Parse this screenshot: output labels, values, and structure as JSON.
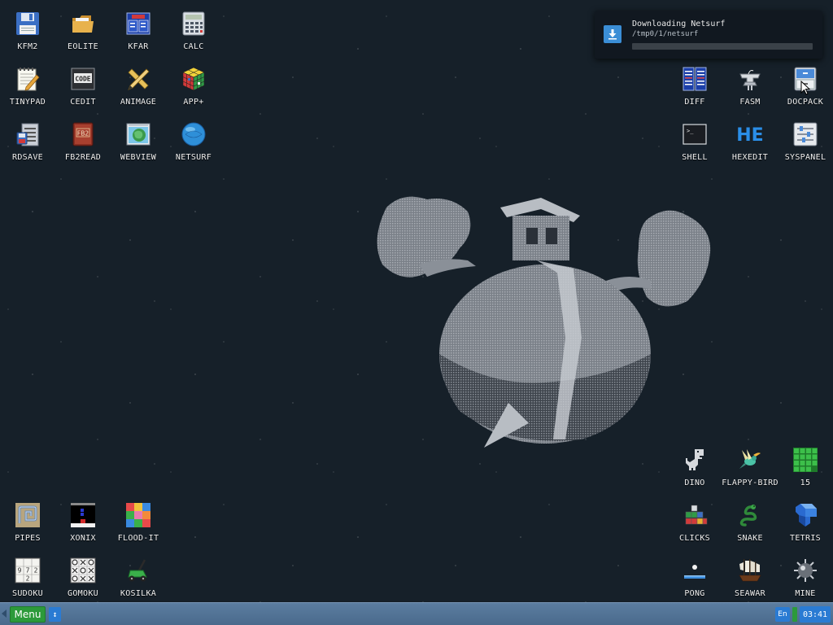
{
  "desktop": {
    "icons": {
      "kfm2": "KFM2",
      "eolite": "EOLITE",
      "kfar": "KFAR",
      "calc": "CALC",
      "tinypad": "TINYPAD",
      "cedit": "CEDIT",
      "animage": "ANIMAGE",
      "app_plus": "APP+",
      "rdsave": "RDSAVE",
      "fb2read": "FB2READ",
      "webview": "WEBVIEW",
      "netsurf": "NETSURF",
      "diff": "DIFF",
      "fasm": "FASM",
      "docpack": "DOCPACK",
      "shell": "SHELL",
      "hexedit": "HEXEDIT",
      "syspanel": "SYSPANEL",
      "dino": "DINO",
      "flappy_bird": "FLAPPY-BIRD",
      "n15": "15",
      "clicks": "CLICKS",
      "snake": "SNAKE",
      "tetris": "TETRIS",
      "pong": "PONG",
      "seawar": "SEAWAR",
      "mine": "MINE",
      "pipes": "PIPES",
      "xonix": "XONIX",
      "flood_it": "FLOOD-IT",
      "sudoku": "SUDOKU",
      "gomoku": "GOMOKU",
      "kosilka": "KOSILKA"
    },
    "icon_glyph_text": {
      "cedit": "CODE",
      "fb2read": "FB2",
      "hexedit": "HE",
      "shell_prompt": ">_",
      "sudoku_digits": [
        "9",
        "7",
        "2",
        "2"
      ]
    }
  },
  "notification": {
    "title": "Downloading Netsurf",
    "path": "/tmp0/1/netsurf",
    "progress": 0,
    "icon": "download-icon"
  },
  "taskbar": {
    "menu_label": "Menu",
    "scroll_glyph": "↕",
    "language": "En",
    "clock": "03:41"
  },
  "colors": {
    "desktop_bg": "#162029",
    "taskbar": "#5578a0",
    "menu_button": "#2c9a3a",
    "accent_blue": "#2a7bd3"
  }
}
